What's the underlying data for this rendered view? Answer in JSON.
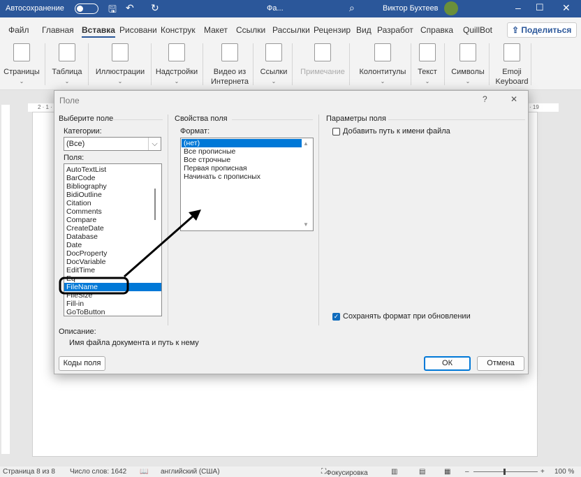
{
  "titlebar": {
    "autosave": "Автосохранение",
    "doc": "Фа...",
    "user": "Виктор Бухтеев"
  },
  "tabs": [
    "Файл",
    "Главная",
    "Вставка",
    "Рисовани",
    "Конструк",
    "Макет",
    "Ссылки",
    "Рассылки",
    "Рецензир",
    "Вид",
    "Разработ",
    "Справка",
    "QuillBot"
  ],
  "active_tab": "Вставка",
  "share": "Поделиться",
  "ribbon": [
    {
      "label": "Страницы",
      "dd": true
    },
    {
      "label": "Таблица",
      "dd": true
    },
    {
      "label": "Иллюстрации",
      "dd": true
    },
    {
      "label": "Надстройки",
      "dd": true
    },
    {
      "label": "Видео из Интернета",
      "dd": false
    },
    {
      "label": "Ссылки",
      "dd": true
    },
    {
      "label": "Примечание",
      "dd": false,
      "disabled": true
    },
    {
      "label": "Колонтитулы",
      "dd": true
    },
    {
      "label": "Текст",
      "dd": true
    },
    {
      "label": "Символы",
      "dd": true
    },
    {
      "label": "Emoji Keyboard",
      "dd": false
    }
  ],
  "ruler": {
    "left": "2 · 1 ·",
    "right": "· 19"
  },
  "dialog": {
    "title": "Поле",
    "help": "?",
    "close": "✕",
    "select_group": "Выберите поле",
    "categories_label": "Категории:",
    "categories_value": "(Все)",
    "fields_label": "Поля:",
    "fields": [
      "AutoTextList",
      "BarCode",
      "Bibliography",
      "BidiOutline",
      "Citation",
      "Comments",
      "Compare",
      "CreateDate",
      "Database",
      "Date",
      "DocProperty",
      "DocVariable",
      "EditTime",
      "Eq",
      "FileName",
      "FileSize",
      "Fill-in",
      "GoToButton"
    ],
    "selected_field": "FileName",
    "props_group": "Свойства поля",
    "format_label": "Формат:",
    "formats": [
      "(нет)",
      "Все прописные",
      "Все строчные",
      "Первая прописная",
      "Начинать с прописных"
    ],
    "selected_format": "(нет)",
    "params_group": "Параметры поля",
    "add_path": {
      "label": "Добавить путь к имени файла",
      "checked": false
    },
    "preserve": {
      "label": "Сохранять формат при обновлении",
      "checked": true
    },
    "description_label": "Описание:",
    "description": "Имя файла документа и путь к нему",
    "codes_button": "Коды поля",
    "ok_button": "ОК",
    "cancel_button": "Отмена"
  },
  "status": {
    "page": "Страница 8 из 8",
    "words": "Число слов: 1642",
    "lang": "английский (США)",
    "focus": "Фокусировка",
    "zoom": "100 %",
    "zoom_level": 100
  },
  "colors": {
    "titlebar": "#2b579a",
    "selection": "#0078d7",
    "annotation": "#000000"
  }
}
